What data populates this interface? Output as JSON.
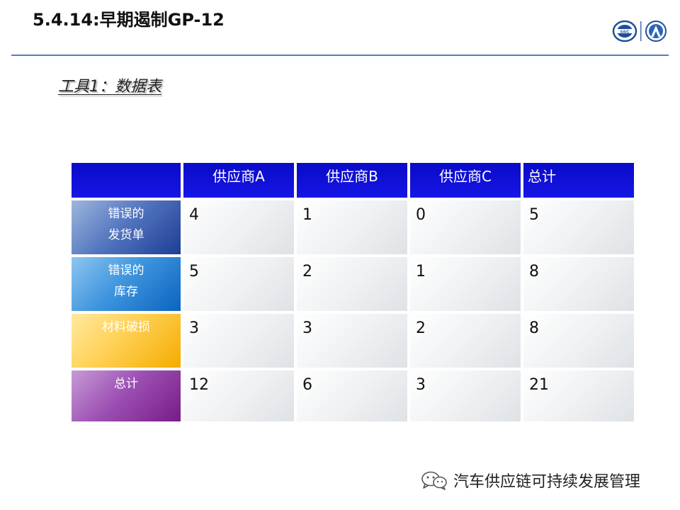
{
  "header": {
    "title": "5.4.14:早期遏制GP-12",
    "logos": [
      "saic-logo",
      "brand-a-logo"
    ]
  },
  "subtitle": "工具1：数据表",
  "table": {
    "columns": [
      "",
      "供应商A",
      "供应商B",
      "供应商C",
      "总计"
    ],
    "rows": [
      {
        "label_line1": "错误的",
        "label_line2": "发货单",
        "values": [
          "4",
          "1",
          "0",
          "5"
        ]
      },
      {
        "label_line1": "错误的",
        "label_line2": "库存",
        "values": [
          "5",
          "2",
          "1",
          "8"
        ]
      },
      {
        "label_line1": "材料破损",
        "label_line2": "",
        "values": [
          "3",
          "3",
          "2",
          "8"
        ]
      },
      {
        "label_line1": "总计",
        "label_line2": "",
        "values": [
          "12",
          "6",
          "3",
          "21"
        ]
      }
    ]
  },
  "footer": {
    "icon": "wechat-icon",
    "text": "汽车供应链可持续发展管理"
  },
  "colors": {
    "title_rule": "#4f7fc4",
    "header_blue": "#1010dc",
    "row1": "#2d4ea4",
    "row2": "#1f7fd6",
    "row3": "#ffc21a",
    "row4": "#8a2a9c"
  }
}
